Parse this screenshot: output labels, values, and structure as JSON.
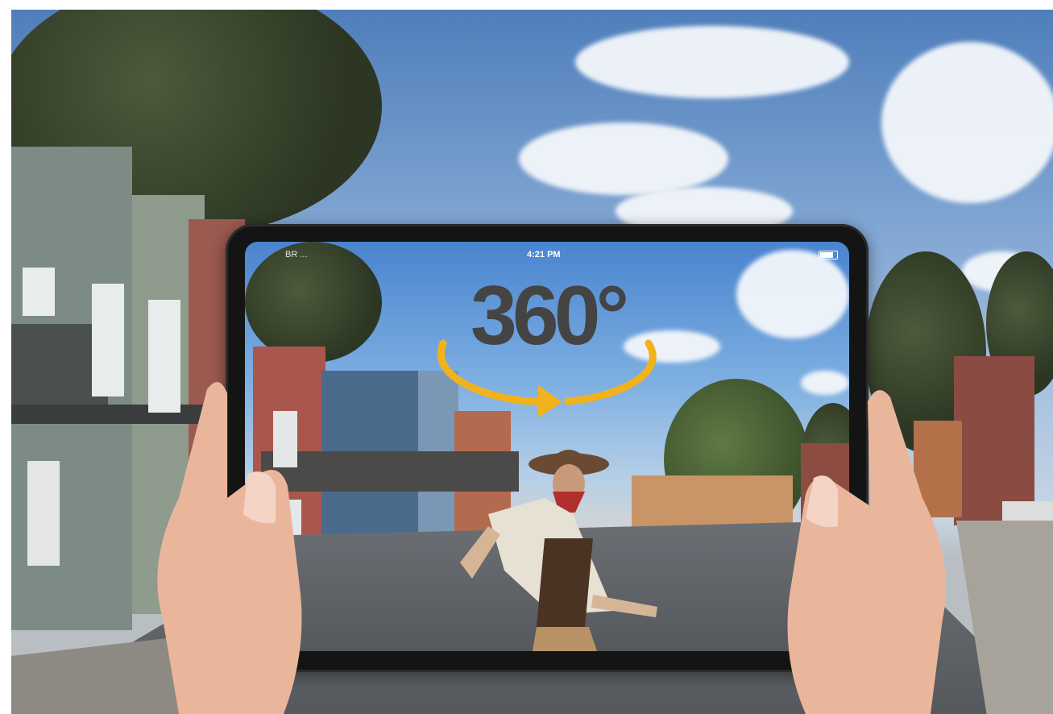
{
  "ar_screen": {
    "status_bar": {
      "carrier": "BR ...",
      "time": "4:21 PM"
    },
    "badge_text": "360°"
  },
  "colors": {
    "badge_text": "#444444",
    "rotation_arrow": "#f2b21c",
    "tablet_frame": "#141414",
    "sky_top": "#4f7ebb"
  },
  "icons": [
    "rotation-arrow-icon",
    "battery-icon"
  ]
}
